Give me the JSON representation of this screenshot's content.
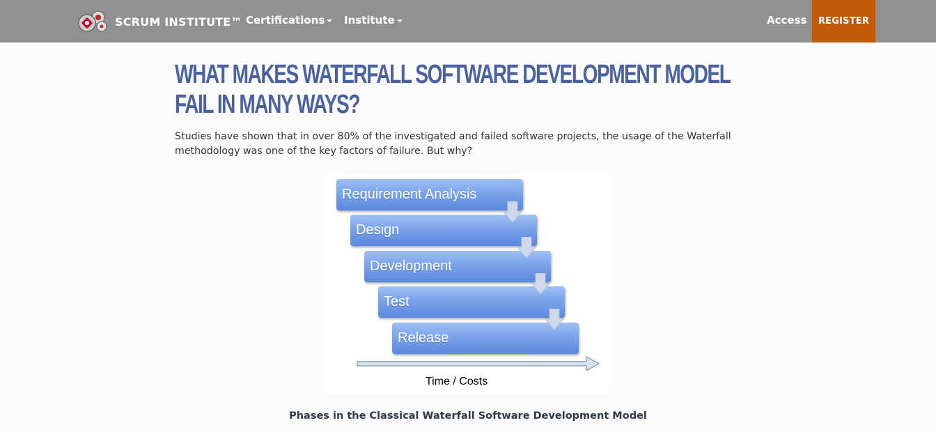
{
  "navbar": {
    "brand": "SCRUM INSTITUTE™",
    "links": [
      {
        "label": "Certifications"
      },
      {
        "label": "Institute"
      }
    ],
    "access_label": "Access",
    "register_label": "REGISTER"
  },
  "article": {
    "title": "What Makes Waterfall Software Development Model Fail In Many Ways?",
    "intro": "Studies have shown that in over 80% of the investigated and failed software projects, the usage of the Waterfall methodology was one of the key factors of failure. But why?",
    "figure": {
      "phases": [
        "Requirement Analysis",
        "Design",
        "Development",
        "Test",
        "Release"
      ],
      "axis_label": "Time / Costs"
    },
    "caption": "Phases in the Classical Waterfall Software Development Model"
  },
  "colors": {
    "navbar_bg": "#919191",
    "register_bg": "#c35a07",
    "title": "#4a62a0",
    "phase_box": "#7aa3ea"
  }
}
